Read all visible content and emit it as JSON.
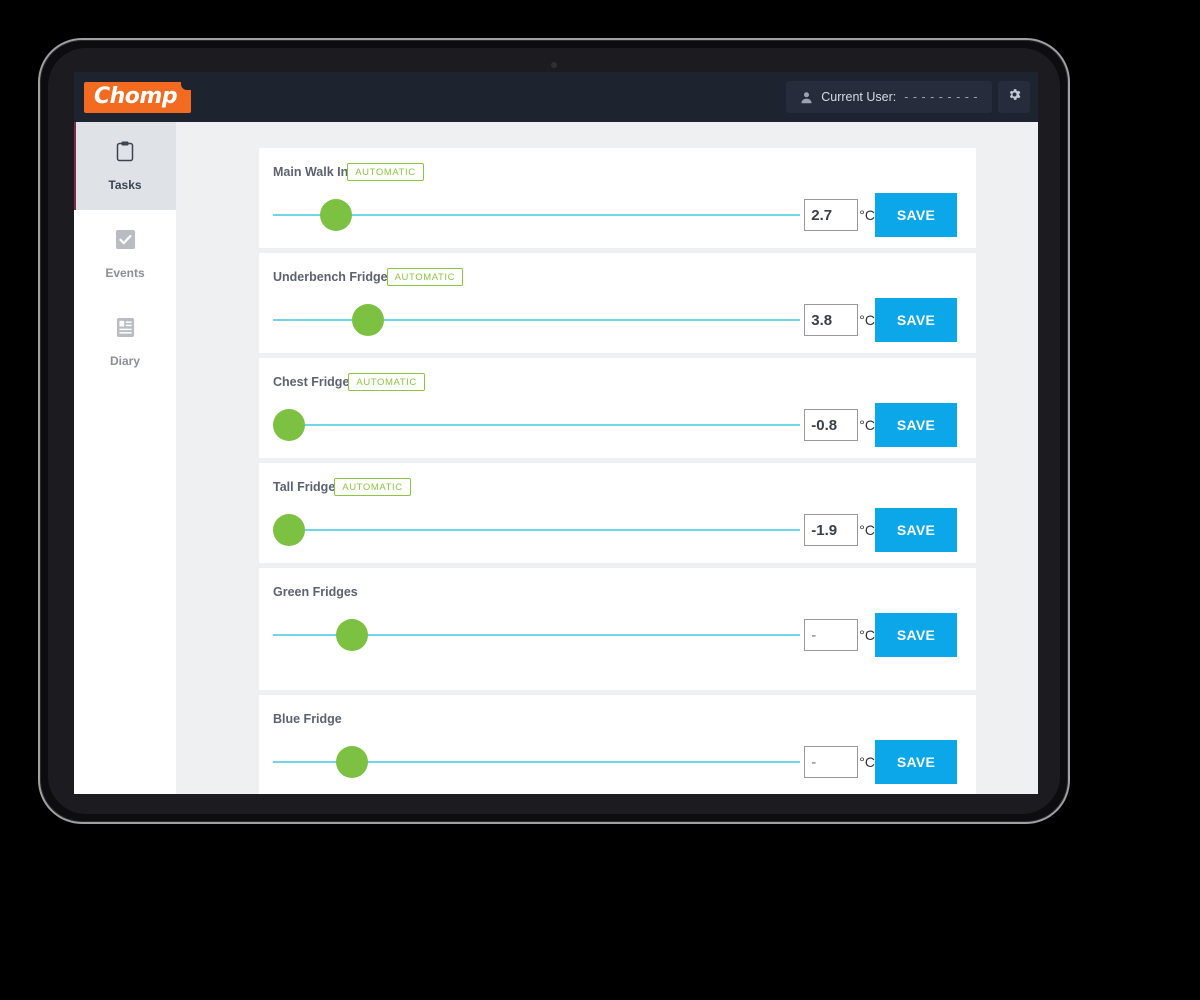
{
  "app": {
    "brand": "Chomp",
    "topbar": {
      "user_label": "Current User:",
      "user_name": "- - - -   - - - - -",
      "user_icon": "person-icon",
      "settings_icon": "gear-icon"
    }
  },
  "sidebar": {
    "items": [
      {
        "label": "Tasks",
        "icon": "clipboard-icon",
        "active": true
      },
      {
        "label": "Events",
        "icon": "checkbox-icon",
        "active": false
      },
      {
        "label": "Diary",
        "icon": "notes-icon",
        "active": false
      }
    ]
  },
  "main": {
    "unit_symbol": "°C",
    "save_label": "SAVE",
    "badge_label": "AUTOMATIC",
    "empty_value_placeholder": "-",
    "fridges": [
      {
        "name": "Main Walk In",
        "automatic": true,
        "value": "2.7",
        "slider_percent": 12
      },
      {
        "name": "Underbench Fridge",
        "automatic": true,
        "value": "3.8",
        "slider_percent": 18
      },
      {
        "name": "Chest Fridge",
        "automatic": true,
        "value": "-0.8",
        "slider_percent": 3
      },
      {
        "name": "Tall Fridge",
        "automatic": true,
        "value": "-1.9",
        "slider_percent": 3
      },
      {
        "name": "Green Fridges",
        "automatic": false,
        "value": "",
        "slider_percent": 15
      },
      {
        "name": "Blue Fridge",
        "automatic": false,
        "value": "",
        "slider_percent": 15
      }
    ]
  },
  "colors": {
    "brand_orange": "#f26b21",
    "topbar_dark": "#1e2330",
    "slider_track": "#6fd7e8",
    "slider_thumb": "#7cc142",
    "save_blue": "#0ba7e8",
    "badge_green": "#8cc63f",
    "content_bg": "#eef0f2"
  }
}
